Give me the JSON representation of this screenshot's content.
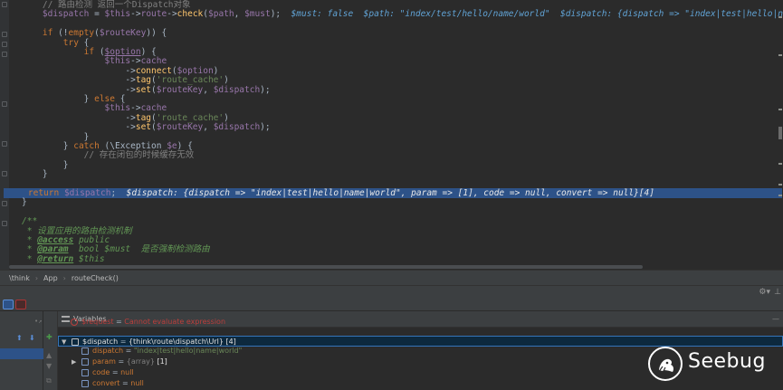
{
  "editor": {
    "lines": [
      {
        "indent": "    ",
        "tokens": [
          [
            "c-cm",
            "// 路由检测 返回一个Dispatch对象"
          ]
        ]
      },
      {
        "indent": "    ",
        "tokens": [
          [
            "c-var",
            "$dispatch"
          ],
          [
            "c-pun",
            " = "
          ],
          [
            "c-var",
            "$this"
          ],
          [
            "c-pun",
            "->"
          ],
          [
            "c-var",
            "route"
          ],
          [
            "c-pun",
            "->"
          ],
          [
            "c-fn",
            "check"
          ],
          [
            "c-pun",
            "("
          ],
          [
            "c-var",
            "$path"
          ],
          [
            "c-pun",
            ", "
          ],
          [
            "c-var",
            "$must"
          ],
          [
            "c-pun",
            ");  "
          ],
          [
            "c-hint",
            "$must: false  $path: \"index/test/hello/name/world\"  $dispatch: {dispatch => \"index|test|hello|name|world\", param =>"
          ]
        ]
      },
      {
        "indent": "",
        "tokens": []
      },
      {
        "indent": "    ",
        "tokens": [
          [
            "c-kw",
            "if"
          ],
          [
            "c-pun",
            " (!"
          ],
          [
            "c-kw",
            "empty"
          ],
          [
            "c-pun",
            "("
          ],
          [
            "c-var",
            "$routeKey"
          ],
          [
            "c-pun",
            ")) {"
          ]
        ]
      },
      {
        "indent": "        ",
        "tokens": [
          [
            "c-kw",
            "try"
          ],
          [
            "c-pun",
            " {"
          ]
        ]
      },
      {
        "indent": "            ",
        "tokens": [
          [
            "c-kw",
            "if"
          ],
          [
            "c-pun",
            " ("
          ],
          [
            "c-var c-ul",
            "$option"
          ],
          [
            "c-pun",
            ") {"
          ]
        ]
      },
      {
        "indent": "                ",
        "tokens": [
          [
            "c-var",
            "$this"
          ],
          [
            "c-pun",
            "->"
          ],
          [
            "c-var",
            "cache"
          ]
        ]
      },
      {
        "indent": "                    ",
        "tokens": [
          [
            "c-pun",
            "->"
          ],
          [
            "c-fn",
            "connect"
          ],
          [
            "c-pun",
            "("
          ],
          [
            "c-var",
            "$option"
          ],
          [
            "c-pun",
            ")"
          ]
        ]
      },
      {
        "indent": "                    ",
        "tokens": [
          [
            "c-pun",
            "->"
          ],
          [
            "c-fn",
            "tag"
          ],
          [
            "c-pun",
            "("
          ],
          [
            "c-str",
            "'route_cache'"
          ],
          [
            "c-pun",
            ")"
          ]
        ]
      },
      {
        "indent": "                    ",
        "tokens": [
          [
            "c-pun",
            "->"
          ],
          [
            "c-fn",
            "set"
          ],
          [
            "c-pun",
            "("
          ],
          [
            "c-var",
            "$routeKey"
          ],
          [
            "c-pun",
            ", "
          ],
          [
            "c-var",
            "$dispatch"
          ],
          [
            "c-pun",
            ");"
          ]
        ]
      },
      {
        "indent": "            ",
        "tokens": [
          [
            "c-pun",
            "} "
          ],
          [
            "c-kw",
            "else"
          ],
          [
            "c-pun",
            " {"
          ]
        ]
      },
      {
        "indent": "                ",
        "tokens": [
          [
            "c-var",
            "$this"
          ],
          [
            "c-pun",
            "->"
          ],
          [
            "c-var",
            "cache"
          ]
        ]
      },
      {
        "indent": "                    ",
        "tokens": [
          [
            "c-pun",
            "->"
          ],
          [
            "c-fn",
            "tag"
          ],
          [
            "c-pun",
            "("
          ],
          [
            "c-str",
            "'route_cache'"
          ],
          [
            "c-pun",
            ")"
          ]
        ]
      },
      {
        "indent": "                    ",
        "tokens": [
          [
            "c-pun",
            "->"
          ],
          [
            "c-fn",
            "set"
          ],
          [
            "c-pun",
            "("
          ],
          [
            "c-var",
            "$routeKey"
          ],
          [
            "c-pun",
            ", "
          ],
          [
            "c-var",
            "$dispatch"
          ],
          [
            "c-pun",
            ");"
          ]
        ]
      },
      {
        "indent": "            ",
        "tokens": [
          [
            "c-pun",
            "}"
          ]
        ]
      },
      {
        "indent": "        ",
        "tokens": [
          [
            "c-pun",
            "} "
          ],
          [
            "c-kw",
            "catch"
          ],
          [
            "c-pun",
            " (\\Exception "
          ],
          [
            "c-var",
            "$e"
          ],
          [
            "c-pun",
            ") {"
          ]
        ]
      },
      {
        "indent": "            ",
        "tokens": [
          [
            "c-cm",
            "// 存在闭包的时候缓存无效"
          ]
        ]
      },
      {
        "indent": "        ",
        "tokens": [
          [
            "c-pun",
            "}"
          ]
        ]
      },
      {
        "indent": "    ",
        "tokens": [
          [
            "c-pun",
            "}"
          ]
        ]
      },
      {
        "indent": "",
        "tokens": []
      },
      {
        "indent": "    ",
        "highlight": true,
        "tokens": [
          [
            "c-kw",
            "return"
          ],
          [
            "c-pun",
            " "
          ],
          [
            "c-var",
            "$dispatch"
          ],
          [
            "c-pun",
            ";  "
          ],
          [
            "c-hint-hl",
            "$dispatch: {dispatch => \"index|test|hello|name|world\", param => [1], code => null, convert => null}[4]"
          ]
        ]
      },
      {
        "indent": "",
        "tokens": [
          [
            "c-pun",
            "}"
          ]
        ]
      },
      {
        "indent": "",
        "tokens": []
      },
      {
        "indent": "",
        "tokens": [
          [
            "c-doc",
            "/**"
          ]
        ]
      },
      {
        "indent": " ",
        "tokens": [
          [
            "c-doc",
            "* 设置应用的路由检测机制"
          ]
        ]
      },
      {
        "indent": " ",
        "tokens": [
          [
            "c-doc",
            "* "
          ],
          [
            "c-dtag",
            "@access"
          ],
          [
            "c-doc",
            " public"
          ]
        ]
      },
      {
        "indent": " ",
        "tokens": [
          [
            "c-doc",
            "* "
          ],
          [
            "c-dtag",
            "@param"
          ],
          [
            "c-doc",
            "  bool $must  是否强制检测路由"
          ]
        ]
      },
      {
        "indent": " ",
        "tokens": [
          [
            "c-doc",
            "* "
          ],
          [
            "c-dtag",
            "@return"
          ],
          [
            "c-doc",
            " $this"
          ]
        ]
      }
    ]
  },
  "breadcrumb": {
    "items": [
      "\\think",
      "App",
      "routeCheck()"
    ],
    "separator": "›"
  },
  "debug": {
    "variables_label": "Variables",
    "variables": [
      {
        "level": 0,
        "expand": "",
        "icon": "error",
        "name": "$request",
        "value": "Cannot evaluate expression",
        "style": "err",
        "partial": true
      },
      {
        "level": 0,
        "expand": "▼",
        "icon": "object",
        "name": "$dispatch",
        "value": "{think\\route\\dispatch\\Url} [4]",
        "style": "obj",
        "selected": true
      },
      {
        "level": 1,
        "expand": "",
        "icon": "field",
        "name": "dispatch",
        "value": "\"index|test|hello|name|world\"",
        "style": "str"
      },
      {
        "level": 1,
        "expand": "▶",
        "icon": "array",
        "name": "param",
        "type": "{array}",
        "value": "[1]",
        "style": "arr"
      },
      {
        "level": 1,
        "expand": "",
        "icon": "field",
        "name": "code",
        "value": "null",
        "style": "null"
      },
      {
        "level": 1,
        "expand": "",
        "icon": "field",
        "name": "convert",
        "value": "null",
        "style": "null"
      }
    ]
  },
  "icons": {
    "settings": "gear-icon",
    "pin": "pin-icon",
    "logo": "seebug-logo"
  },
  "watermark": {
    "text": "Seebug"
  },
  "colors": {
    "editor_bg": "#2b2b2b",
    "panel_bg": "#3c3f41",
    "highlight_line": "#2d5288",
    "selected_row": "#0d293e",
    "keyword": "#cc7832",
    "variable": "#9876aa",
    "function": "#ffc66d",
    "string": "#6a8759",
    "inline_hint": "#61a3d5"
  }
}
